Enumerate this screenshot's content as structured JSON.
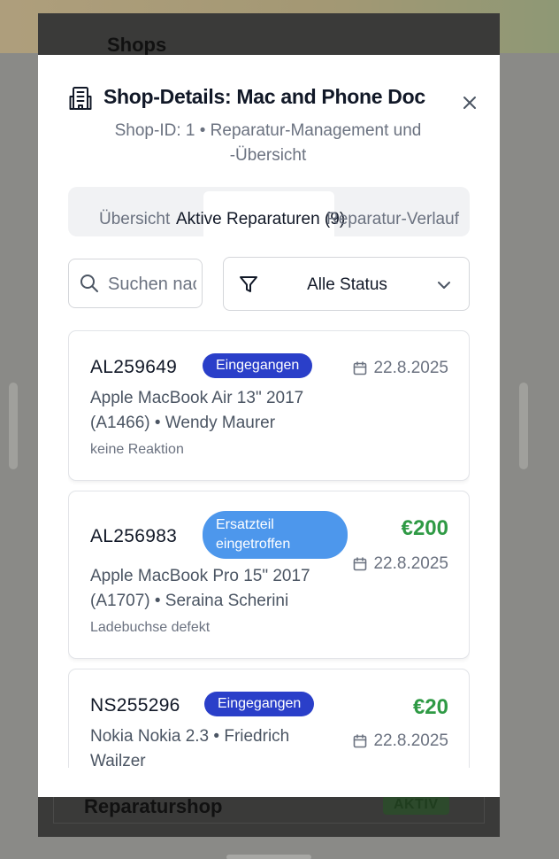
{
  "background": {
    "page_title": "Shops",
    "shop_card_name": "Reparaturshop",
    "shop_card_status": "AKTIV"
  },
  "modal": {
    "title": "Shop-Details: Mac and Phone Doc",
    "subtitle": "Shop-ID: 1 • Reparatur-Management und -Übersicht",
    "close_icon": "close-icon",
    "header_icon": "building-icon"
  },
  "tabs": [
    {
      "label": "Übersicht",
      "active": false
    },
    {
      "label": "Aktive Reparaturen (9)",
      "active": true
    },
    {
      "label": "Reparatur-Verlauf",
      "active": false
    }
  ],
  "filters": {
    "search_placeholder": "Suchen nach...",
    "status_value": "Alle Status"
  },
  "repairs": [
    {
      "id": "AL259649",
      "status": "Eingegangen",
      "status_color": "#2a3fc9",
      "device": "Apple MacBook Air 13\" 2017 (A1466) • Wendy Maurer",
      "issue": "keine Reaktion",
      "price": "",
      "date": "22.8.2025"
    },
    {
      "id": "AL256983",
      "status": "Ersatzteil eingetroffen",
      "status_color": "#4d97ec",
      "device": "Apple MacBook Pro 15\" 2017 (A1707) • Seraina Scherini",
      "issue": "Ladebuchse defekt",
      "price": "€200",
      "date": "22.8.2025"
    },
    {
      "id": "NS255296",
      "status": "Eingegangen",
      "status_color": "#2a3fc9",
      "device": "Nokia Nokia 2.3 • Friedrich Wailzer",
      "issue": "",
      "price": "€20",
      "date": "22.8.2025"
    }
  ],
  "colors": {
    "price_green": "#2f9a45",
    "badge_dark_blue": "#2a3fc9",
    "badge_light_blue": "#4d97ec"
  }
}
